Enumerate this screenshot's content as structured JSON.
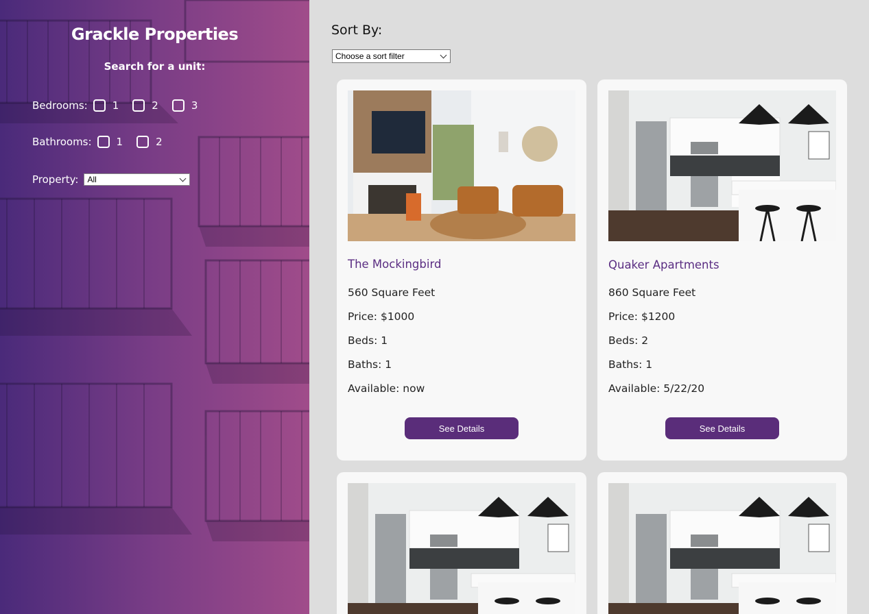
{
  "sidebar": {
    "brand": "Grackle Properties",
    "search_label": "Search for a unit:",
    "bedrooms": {
      "label": "Bedrooms:",
      "options": [
        "1",
        "2",
        "3"
      ]
    },
    "bathrooms": {
      "label": "Bathrooms:",
      "options": [
        "1",
        "2"
      ]
    },
    "property": {
      "label": "Property:",
      "selected": "All"
    }
  },
  "sort": {
    "title": "Sort By:",
    "selected": "Choose a sort filter"
  },
  "listings": [
    {
      "name": "The Mockingbird",
      "sqft": "560 Square Feet",
      "price": "Price: $1000",
      "beds": "Beds: 1",
      "baths": "Baths: 1",
      "available": "Available: now",
      "button": "See Details",
      "image": "living-room-photo"
    },
    {
      "name": "Quaker Apartments",
      "sqft": "860 Square Feet",
      "price": "Price: $1200",
      "beds": "Beds: 2",
      "baths": "Baths: 1",
      "available": "Available: 5/22/20",
      "button": "See Details",
      "image": "kitchen-photo"
    },
    {
      "image": "kitchen-photo"
    },
    {
      "image": "kitchen-photo"
    }
  ],
  "colors": {
    "accent": "#5a2d7a",
    "title": "#5a2d82",
    "main_bg": "#dddddd",
    "card_bg": "#f8f8f8"
  }
}
